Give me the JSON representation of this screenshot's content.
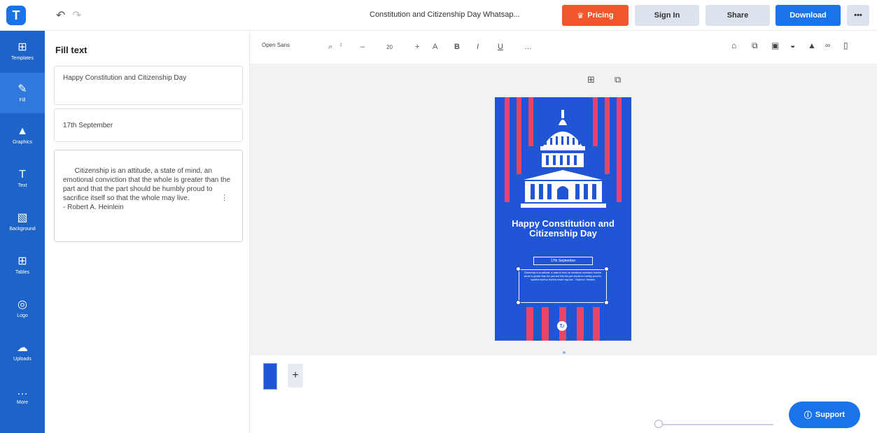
{
  "topbar": {
    "logo": "T",
    "undo_icon": "undo-icon",
    "redo_icon": "redo-icon",
    "title": "Constitution and Citizenship Day Whatsap...",
    "pricing": "Pricing",
    "sign_in": "Sign In",
    "share": "Share",
    "download": "Download",
    "more": "•••"
  },
  "rail": [
    {
      "label": "Templates",
      "icon": "⊞"
    },
    {
      "label": "Fill",
      "icon": "✎"
    },
    {
      "label": "Graphics",
      "icon": "▲"
    },
    {
      "label": "Text",
      "icon": "T"
    },
    {
      "label": "Background",
      "icon": "▧"
    },
    {
      "label": "Tables",
      "icon": "⊞"
    },
    {
      "label": "Logo",
      "icon": "◎"
    },
    {
      "label": "Uploads",
      "icon": "☁"
    },
    {
      "label": "More",
      "icon": "…"
    }
  ],
  "panel": {
    "title": "Fill text",
    "fields": [
      "Happy Constitution and Citizenship Day",
      "17th September",
      "Citizenship is an attitude, a state of mind, an emotional conviction that the whole is greater than the part and that the part should be humbly proud to sacrifice itself so that the whole may live.\n- Robert A. Heinlein"
    ]
  },
  "toolbar": {
    "font": "Open Sans",
    "font_size": "20"
  },
  "poster": {
    "title": "Happy Constitution and Citizenship Day",
    "date": "17th September",
    "quote": "Citizenship is an attitude, a state of mind, an emotional conviction that the whole is greater than the part and that the part should be humbly proud to sacrifice itself so that the whole may live. - Robert A. Heinlein"
  },
  "colors": {
    "accent": "#1a73e8",
    "pricing": "#f0572a",
    "poster_blue": "#2055d6",
    "poster_red": "#e84465"
  },
  "support": {
    "label": "Support"
  }
}
